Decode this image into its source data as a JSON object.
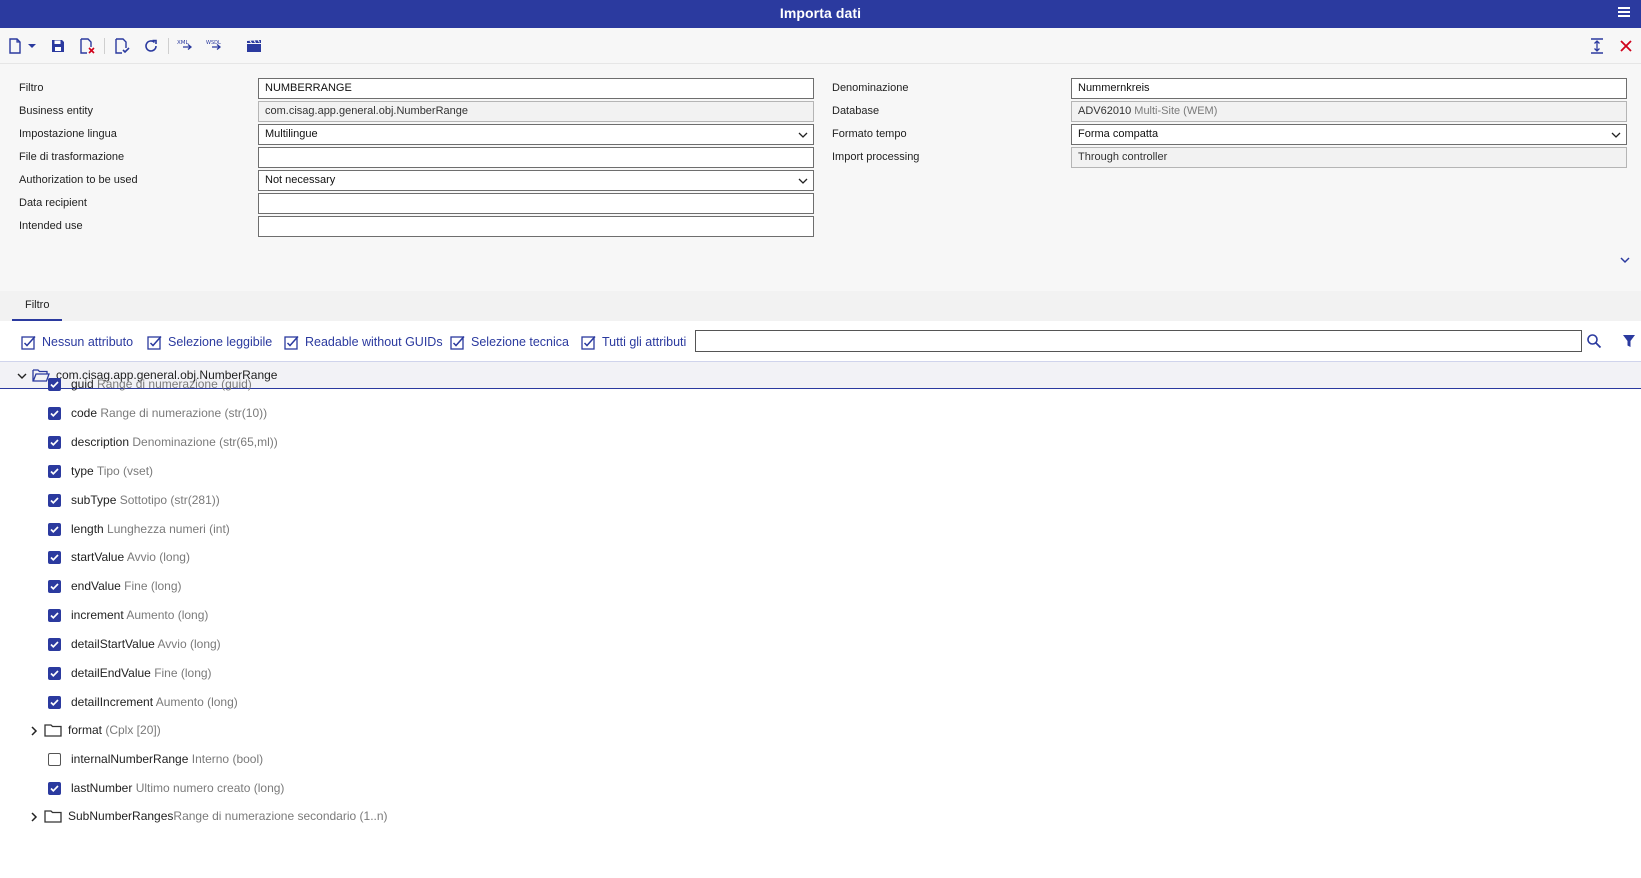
{
  "window": {
    "title": "Importa dati"
  },
  "form": {
    "left": [
      {
        "label": "Filtro",
        "value": "NUMBERRANGE",
        "kind": "input"
      },
      {
        "label": "Business entity",
        "value": "com.cisag.app.general.obj.NumberRange",
        "kind": "readonly"
      },
      {
        "label": "Impostazione lingua",
        "value": "Multilingue",
        "kind": "select"
      },
      {
        "label": "File di trasformazione",
        "value": "",
        "kind": "input"
      },
      {
        "label": "Authorization to be used",
        "value": "Not necessary",
        "kind": "select"
      },
      {
        "label": "Data recipient",
        "value": "",
        "kind": "input"
      },
      {
        "label": "Intended use",
        "value": "",
        "kind": "input"
      }
    ],
    "right": [
      {
        "label": "Denominazione",
        "value": "Nummernkreis",
        "kind": "input"
      },
      {
        "label": "Database",
        "value": "ADV62010",
        "value_muted": "Multi-Site (WEM)",
        "kind": "readonly"
      },
      {
        "label": "Formato tempo",
        "value": "Forma compatta",
        "kind": "select"
      },
      {
        "label": "Import processing",
        "value": "Through controller",
        "kind": "readonly"
      }
    ]
  },
  "tabs": [
    {
      "label": "Filtro",
      "active": true
    }
  ],
  "attr_buttons": [
    "Nessun attributo",
    "Selezione leggibile",
    "Readable without GUIDs",
    "Selezione tecnica",
    "Tutti gli attributi"
  ],
  "search": {
    "value": ""
  },
  "tree": {
    "root": "com.cisag.app.general.obj.NumberRange",
    "rows": [
      {
        "type": "attr",
        "checked": true,
        "name": "guid",
        "desc": "Range di numerazione (guid)"
      },
      {
        "type": "attr",
        "checked": true,
        "name": "code",
        "desc": "Range di numerazione (str(10))"
      },
      {
        "type": "attr",
        "checked": true,
        "name": "description",
        "desc": "Denominazione (str(65,ml))"
      },
      {
        "type": "attr",
        "checked": true,
        "name": "type",
        "desc": "Tipo (vset)"
      },
      {
        "type": "attr",
        "checked": true,
        "name": "subType",
        "desc": "Sottotipo (str(281))"
      },
      {
        "type": "attr",
        "checked": true,
        "name": "length",
        "desc": "Lunghezza numeri (int)"
      },
      {
        "type": "attr",
        "checked": true,
        "name": "startValue",
        "desc": "Avvio (long)"
      },
      {
        "type": "attr",
        "checked": true,
        "name": "endValue",
        "desc": "Fine (long)"
      },
      {
        "type": "attr",
        "checked": true,
        "name": "increment",
        "desc": "Aumento (long)"
      },
      {
        "type": "attr",
        "checked": true,
        "name": "detailStartValue",
        "desc": "Avvio (long)"
      },
      {
        "type": "attr",
        "checked": true,
        "name": "detailEndValue",
        "desc": "Fine (long)"
      },
      {
        "type": "attr",
        "checked": true,
        "name": "detailIncrement",
        "desc": "Aumento (long)"
      },
      {
        "type": "group",
        "name": "format",
        "desc": " (Cplx [20])"
      },
      {
        "type": "attr",
        "checked": false,
        "name": "internalNumberRange",
        "desc": "Interno (bool)"
      },
      {
        "type": "attr",
        "checked": true,
        "name": "lastNumber",
        "desc": "Ultimo numero creato (long)"
      },
      {
        "type": "group",
        "name": "SubNumberRanges",
        "desc": "Range di numerazione secondario (1..n)"
      }
    ]
  },
  "colors": {
    "accent": "#2b3a9f",
    "close": "#d0021b",
    "muted": "#7a7a7a"
  }
}
